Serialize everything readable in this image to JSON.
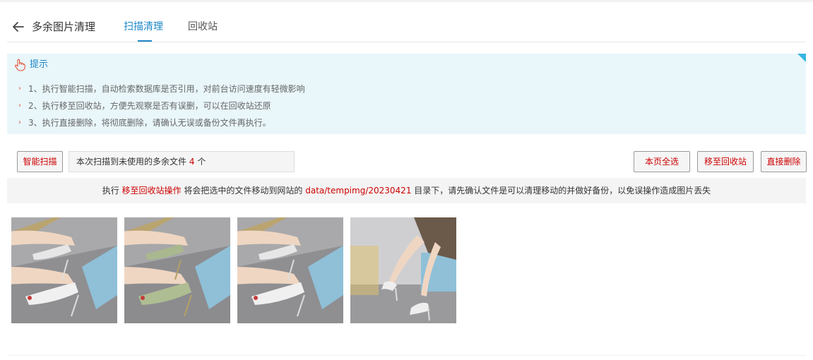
{
  "header": {
    "title": "多余图片清理",
    "tabs": [
      {
        "label": "扫描清理",
        "active": true
      },
      {
        "label": "回收站",
        "active": false
      }
    ]
  },
  "tips": {
    "title": "提示",
    "items": [
      "1、执行智能扫描，自动检索数据库是否引用，对前台访问速度有轻微影响",
      "2、执行移至回收站，方便先观察是否有误删，可以在回收站还原",
      "3、执行直接删除，将彻底删除，请确认无误或备份文件再执行。"
    ]
  },
  "toolbar": {
    "smart_scan_label": "智能扫描",
    "result_prefix": "本次扫描到未使用的多余文件",
    "result_count": "4",
    "result_suffix": "个",
    "select_page_label": "本页全选",
    "move_to_recycle_label": "移至回收站",
    "delete_label": "直接删除"
  },
  "notice": {
    "part1": "执行",
    "highlight1": "移至回收站操作",
    "part2": "将会把选中的文件移动到网站的",
    "path": "data/tempimg/20230421",
    "part3": "目录下，请先确认文件是可以清理移动的并做好备份，以免误操作造成图片丢失"
  },
  "colors": {
    "accent": "#1e88c7",
    "danger": "#cc0000",
    "tips_bg": "#e9f6fa"
  },
  "icons": [
    "back-arrow-icon",
    "hand-pointer-icon"
  ],
  "thumbnails": [
    {
      "variant": "white"
    },
    {
      "variant": "green"
    },
    {
      "variant": "white"
    },
    {
      "variant": "sitting"
    }
  ]
}
